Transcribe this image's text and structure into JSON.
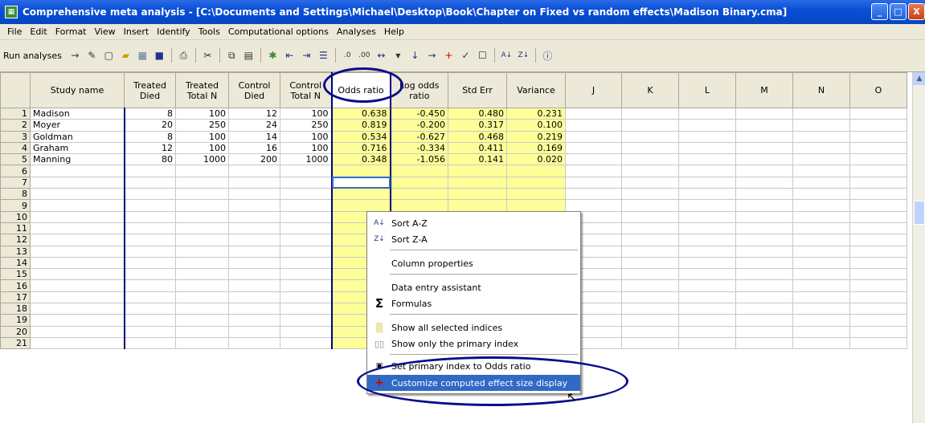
{
  "window": {
    "title": "Comprehensive meta analysis - [C:\\Documents and Settings\\Michael\\Desktop\\Book\\Chapter on Fixed vs random effects\\Madison Binary.cma]",
    "min": "_",
    "max": "□",
    "close": "X"
  },
  "menu": [
    "File",
    "Edit",
    "Format",
    "View",
    "Insert",
    "Identify",
    "Tools",
    "Computational options",
    "Analyses",
    "Help"
  ],
  "toolbar": {
    "run_label": "Run analyses"
  },
  "columns": [
    "Study name",
    "Treated Died",
    "Treated Total N",
    "Control Died",
    "Control Total N",
    "Odds ratio",
    "Log odds ratio",
    "Std Err",
    "Variance",
    "J",
    "K",
    "L",
    "M",
    "N",
    "O"
  ],
  "rows": [
    {
      "n": "1",
      "study": "Madison",
      "td": "8",
      "tn": "100",
      "cd": "12",
      "cn": "100",
      "or": "0.638",
      "lor": "-0.450",
      "se": "0.480",
      "var": "0.231"
    },
    {
      "n": "2",
      "study": "Moyer",
      "td": "20",
      "tn": "250",
      "cd": "24",
      "cn": "250",
      "or": "0.819",
      "lor": "-0.200",
      "se": "0.317",
      "var": "0.100"
    },
    {
      "n": "3",
      "study": "Goldman",
      "td": "8",
      "tn": "100",
      "cd": "14",
      "cn": "100",
      "or": "0.534",
      "lor": "-0.627",
      "se": "0.468",
      "var": "0.219"
    },
    {
      "n": "4",
      "study": "Graham",
      "td": "12",
      "tn": "100",
      "cd": "16",
      "cn": "100",
      "or": "0.716",
      "lor": "-0.334",
      "se": "0.411",
      "var": "0.169"
    },
    {
      "n": "5",
      "study": "Manning",
      "td": "80",
      "tn": "1000",
      "cd": "200",
      "cn": "1000",
      "or": "0.348",
      "lor": "-1.056",
      "se": "0.141",
      "var": "0.020"
    }
  ],
  "empty_rows": [
    "6",
    "7",
    "8",
    "9",
    "10",
    "11",
    "12",
    "13",
    "14",
    "15",
    "16",
    "17",
    "18",
    "19",
    "20",
    "21"
  ],
  "context_menu": {
    "sort_az": "Sort A-Z",
    "sort_za": "Sort Z-A",
    "column_properties": "Column properties",
    "data_entry_assistant": "Data entry assistant",
    "formulas": "Formulas",
    "show_all_indices": "Show all selected indices",
    "show_primary_index": "Show only the primary index",
    "set_primary_index": "Set primary index to Odds ratio",
    "customize_display": "Customize computed effect size display"
  }
}
